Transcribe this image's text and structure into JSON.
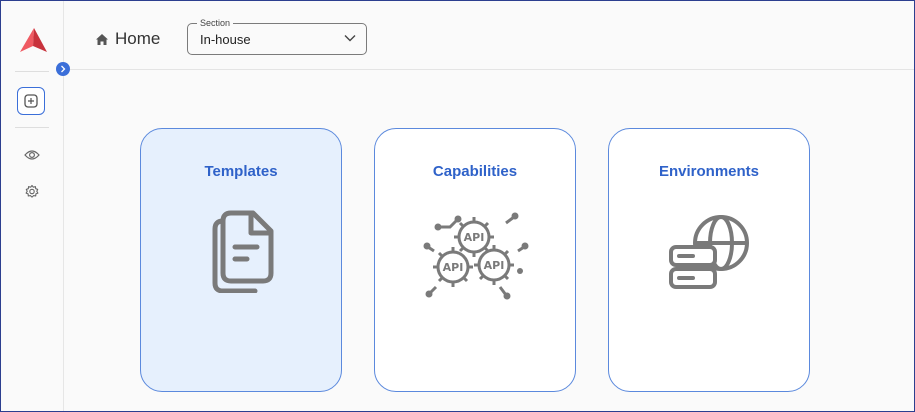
{
  "header": {
    "home_label": "Home",
    "section": {
      "legend": "Section",
      "value": "In-house"
    }
  },
  "sidebar": {
    "items": [
      {
        "icon": "add-square-icon"
      },
      {
        "icon": "eye-icon"
      },
      {
        "icon": "gear-icon"
      }
    ]
  },
  "cards": [
    {
      "title": "Templates",
      "icon": "documents-icon",
      "active": true
    },
    {
      "title": "Capabilities",
      "icon": "api-gears-icon",
      "active": false
    },
    {
      "title": "Environments",
      "icon": "server-globe-icon",
      "active": false
    }
  ],
  "colors": {
    "accent": "#2f62c9",
    "border": "#5b89dd",
    "active_bg": "#e6f0fd",
    "logo": "#e0454f",
    "frame": "#2c3e8f"
  }
}
